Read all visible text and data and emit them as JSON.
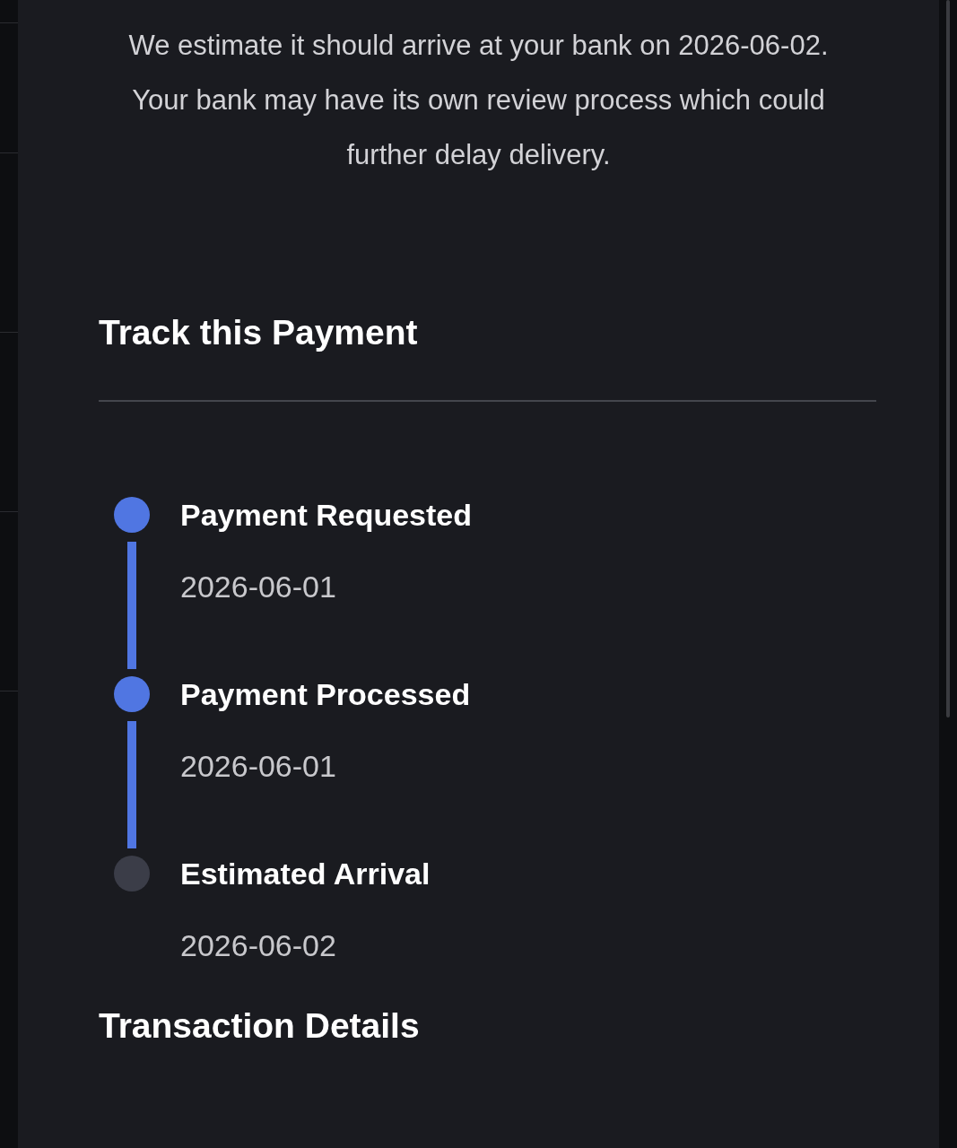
{
  "message": "We estimate it should arrive at your bank on 2026-06-02. Your bank may have its own review process which could further delay delivery.",
  "track_section": {
    "title": "Track this Payment",
    "steps": [
      {
        "title": "Payment Requested",
        "date": "2026-06-01",
        "completed": true
      },
      {
        "title": "Payment Processed",
        "date": "2026-06-01",
        "completed": true
      },
      {
        "title": "Estimated Arrival",
        "date": "2026-06-02",
        "completed": false
      }
    ]
  },
  "details_section": {
    "title": "Transaction Details"
  }
}
